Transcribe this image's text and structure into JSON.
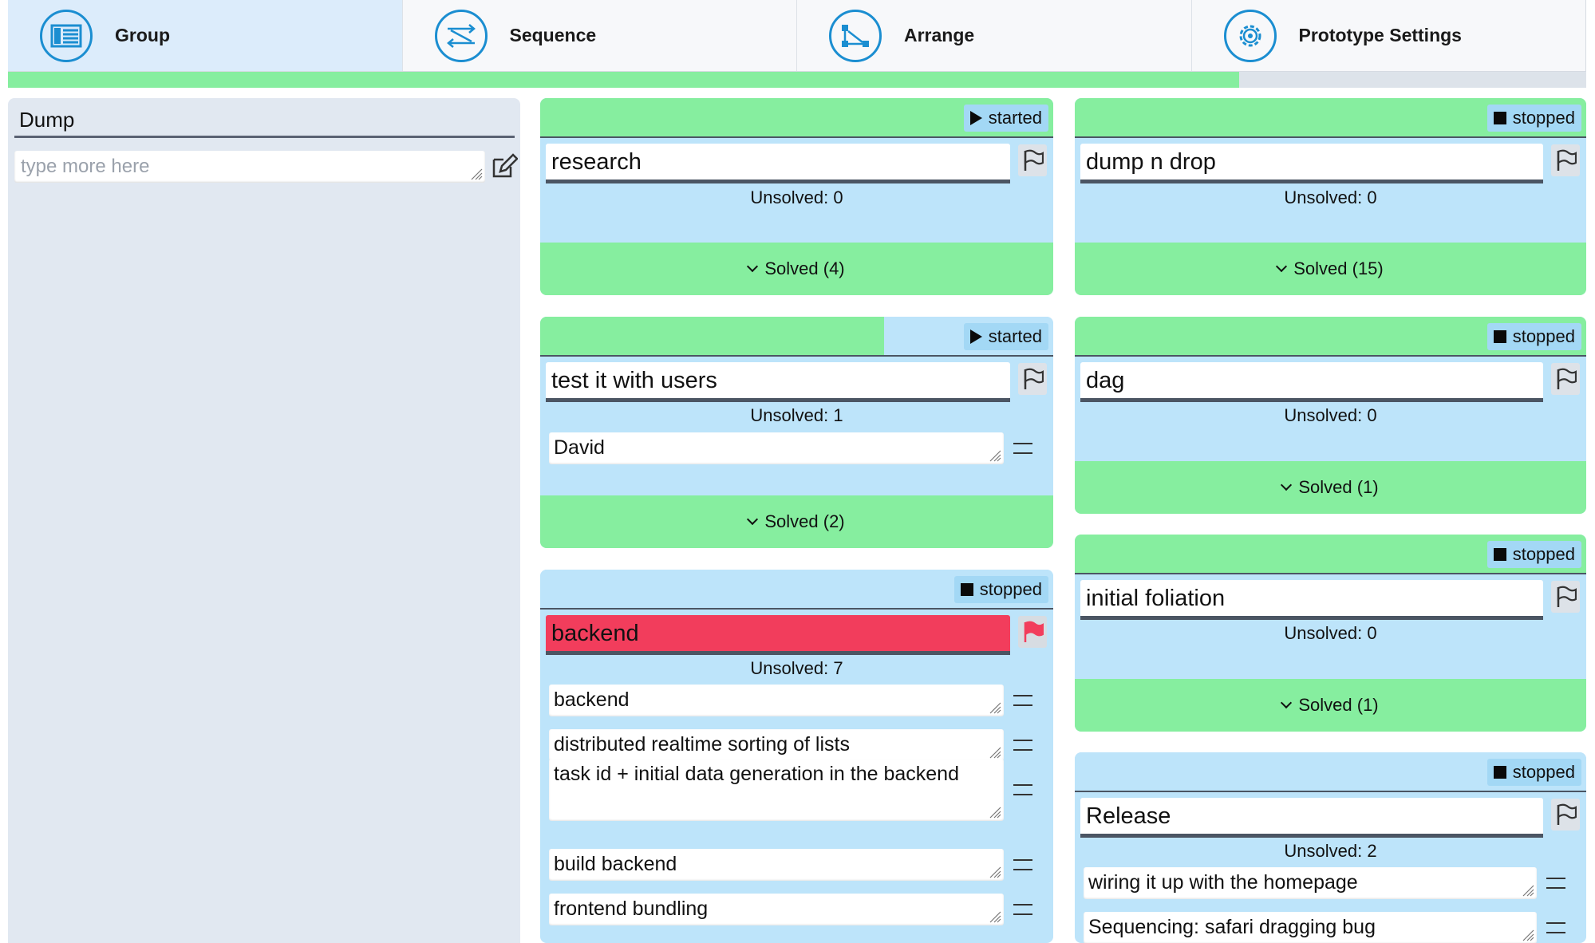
{
  "tabs": [
    {
      "label": "Group",
      "icon": "group-list-icon",
      "active": true
    },
    {
      "label": "Sequence",
      "icon": "sequence-arrows-icon",
      "active": false
    },
    {
      "label": "Arrange",
      "icon": "arrange-graph-icon",
      "active": false
    },
    {
      "label": "Prototype Settings",
      "icon": "settings-gear-icon",
      "active": false
    }
  ],
  "progress": {
    "fraction": 0.78
  },
  "dump": {
    "title": "Dump",
    "placeholder": "type more here",
    "edit_icon": "edit-pencil-icon"
  },
  "cards": [
    {
      "title": "research",
      "status": "started",
      "unsolved_label": "Unsolved: 0",
      "solved_label": "Solved (4)",
      "header_progress": 1.0,
      "flagged": false,
      "tasks": []
    },
    {
      "title": "test it with users",
      "status": "started",
      "unsolved_label": "Unsolved: 1",
      "solved_label": "Solved (2)",
      "header_progress": 0.67,
      "flagged": false,
      "tasks": [
        "David"
      ]
    },
    {
      "title": "backend",
      "status": "stopped",
      "unsolved_label": "Unsolved: 7",
      "solved_label": "",
      "header_progress": 0.0,
      "flagged": true,
      "tasks": [
        "backend",
        "distributed realtime sorting of lists",
        "task id  + initial data generation  in the backend",
        "build backend",
        "frontend bundling"
      ]
    },
    {
      "title": "dump n drop",
      "status": "stopped",
      "unsolved_label": "Unsolved: 0",
      "solved_label": "Solved (15)",
      "header_progress": 1.0,
      "flagged": false,
      "tasks": []
    },
    {
      "title": "dag",
      "status": "stopped",
      "unsolved_label": "Unsolved: 0",
      "solved_label": "Solved (1)",
      "header_progress": 1.0,
      "flagged": false,
      "tasks": []
    },
    {
      "title": "initial foliation",
      "status": "stopped",
      "unsolved_label": "Unsolved: 0",
      "solved_label": "Solved (1)",
      "header_progress": 1.0,
      "flagged": false,
      "tasks": []
    },
    {
      "title": "Release",
      "status": "stopped",
      "unsolved_label": "Unsolved: 2",
      "solved_label": "",
      "header_progress": 0.0,
      "flagged": false,
      "tasks": [
        "wiring it up with the homepage",
        "Sequencing: safari dragging bug"
      ]
    }
  ],
  "colors": {
    "accent": "#1b8ed1",
    "solved_green": "#86ee9f",
    "card_blue": "#bde4fa",
    "flag_red": "#f23d5c"
  }
}
